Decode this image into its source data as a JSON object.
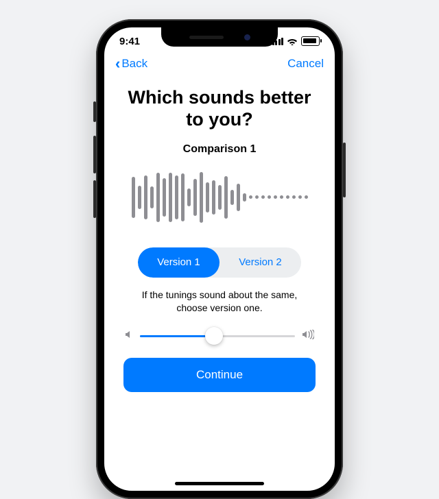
{
  "status": {
    "time": "9:41"
  },
  "nav": {
    "back": "Back",
    "cancel": "Cancel"
  },
  "heading": "Which sounds better to you?",
  "subtitle": "Comparison 1",
  "segment": {
    "option1": "Version 1",
    "option2": "Version 2",
    "selected": 1
  },
  "hint": "If the tunings sound about the same, choose version one.",
  "volume": {
    "percent": 48
  },
  "cta": "Continue",
  "colors": {
    "accent": "#007aff"
  },
  "waveform_heights": [
    60,
    34,
    64,
    32,
    72,
    56,
    72,
    64,
    70,
    26,
    54,
    74,
    44,
    50,
    36,
    62,
    22,
    40,
    12,
    6,
    6,
    6,
    6,
    6,
    6,
    6,
    6,
    6,
    6
  ]
}
